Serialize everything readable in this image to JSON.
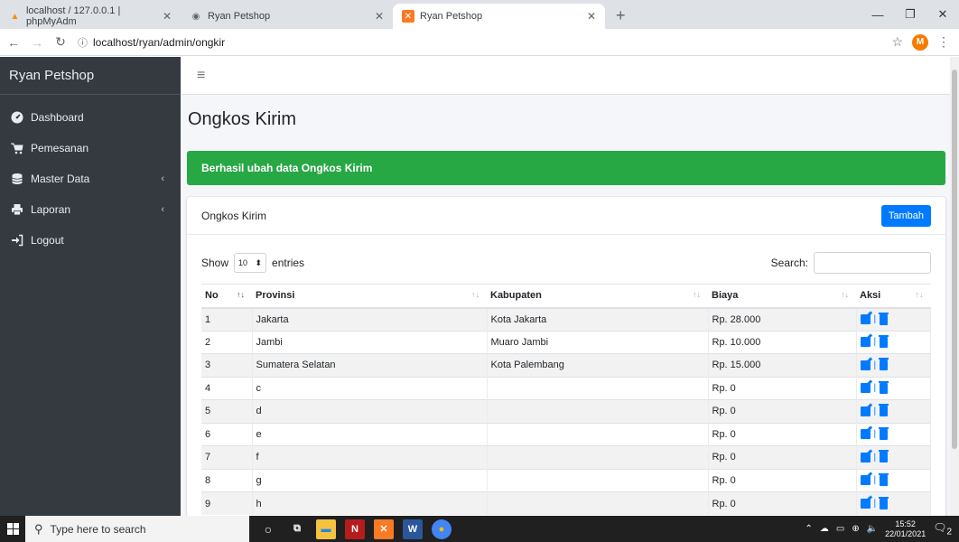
{
  "browser": {
    "tabs": [
      {
        "title": "localhost / 127.0.0.1 | phpMyAdm",
        "icon": "phpmyadmin-icon"
      },
      {
        "title": "Ryan Petshop",
        "icon": "globe-icon"
      },
      {
        "title": "Ryan Petshop",
        "icon": "xampp-icon"
      }
    ],
    "url": "localhost/ryan/admin/ongkir",
    "avatar_letter": "M"
  },
  "sidebar": {
    "brand": "Ryan Petshop",
    "items": [
      {
        "label": "Dashboard",
        "icon": "tachometer-icon"
      },
      {
        "label": "Pemesanan",
        "icon": "cart-icon"
      },
      {
        "label": "Master Data",
        "icon": "database-icon",
        "chevron": "‹"
      },
      {
        "label": "Laporan",
        "icon": "print-icon",
        "chevron": "‹"
      },
      {
        "label": "Logout",
        "icon": "sign-out-icon"
      }
    ]
  },
  "main": {
    "hamburger": "≡",
    "page_title": "Ongkos Kirim",
    "alert": "Berhasil ubah data Ongkos Kirim",
    "card_title": "Ongkos Kirim",
    "add_button": "Tambah",
    "show_label": "Show",
    "entries_value": "10",
    "entries_label": "entries",
    "search_label": "Search:",
    "search_value": ""
  },
  "table": {
    "headers": [
      "No",
      "Provinsi",
      "Kabupaten",
      "Biaya",
      "Aksi"
    ],
    "rows": [
      [
        "1",
        "Jakarta",
        "Kota Jakarta",
        "Rp. 28.000"
      ],
      [
        "2",
        "Jambi",
        "Muaro Jambi",
        "Rp. 10.000"
      ],
      [
        "3",
        "Sumatera Selatan",
        "Kota Palembang",
        "Rp. 15.000"
      ],
      [
        "4",
        "c",
        "",
        "Rp. 0"
      ],
      [
        "5",
        "d",
        "",
        "Rp. 0"
      ],
      [
        "6",
        "e",
        "",
        "Rp. 0"
      ],
      [
        "7",
        "f",
        "",
        "Rp. 0"
      ],
      [
        "8",
        "g",
        "",
        "Rp. 0"
      ],
      [
        "9",
        "h",
        "",
        "Rp. 0"
      ]
    ]
  },
  "taskbar": {
    "search_placeholder": "Type here to search",
    "time": "15:52",
    "date": "22/01/2021",
    "notification_count": "2"
  },
  "colors": {
    "sidebar": "#343a40",
    "alert_success": "#28a745",
    "primary": "#007bff"
  }
}
